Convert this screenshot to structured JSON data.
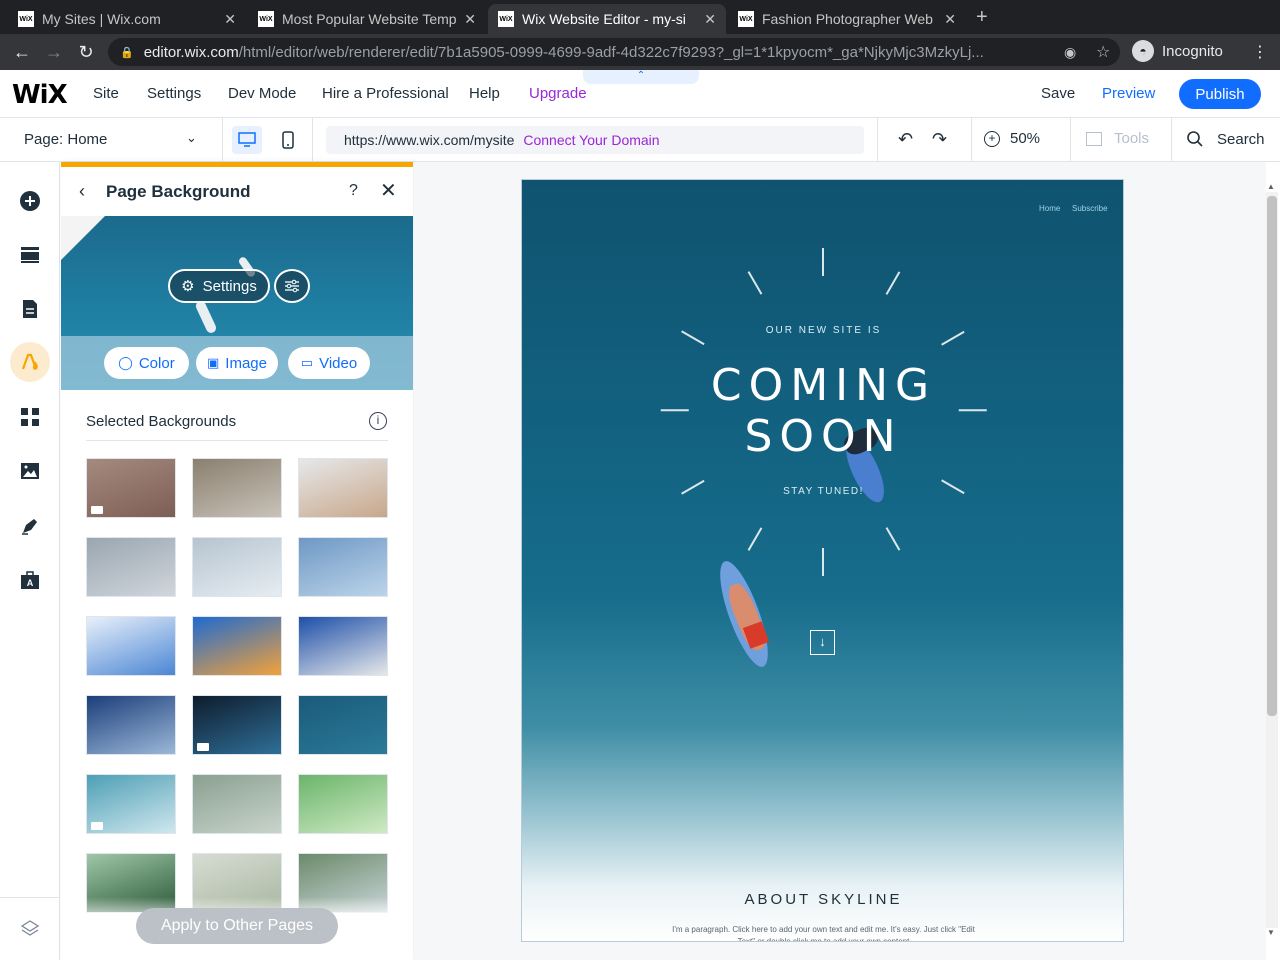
{
  "browser": {
    "tabs": [
      {
        "favicon": "WiX",
        "title": "My Sites | Wix.com",
        "active": false
      },
      {
        "favicon": "WiX",
        "title": "Most Popular Website Temp",
        "active": false
      },
      {
        "favicon": "WiX",
        "title": "Wix Website Editor - my-si",
        "active": true
      },
      {
        "favicon": "WiX",
        "title": "Fashion Photographer Web",
        "active": false
      }
    ],
    "url_host": "editor.wix.com",
    "url_path": "/html/editor/web/renderer/edit/7b1a5905-0999-4699-9adf-4d322c7f9293?_gl=1*1kpyocm*_ga*NjkyMjc3MzkyLj...",
    "profile": "Incognito"
  },
  "wix_bar": {
    "logo": "WiX",
    "menu": [
      "Site",
      "Settings",
      "Dev Mode",
      "Hire a Professional",
      "Help",
      "Upgrade"
    ],
    "save": "Save",
    "preview": "Preview",
    "publish": "Publish"
  },
  "toolbar": {
    "page_label": "Page:",
    "page_value": "Home",
    "site_url": "https://www.wix.com/mysite",
    "connect_domain": "Connect Your Domain",
    "zoom": "50%",
    "tools": "Tools",
    "search": "Search"
  },
  "left_rail": {
    "icons": [
      "add-icon",
      "sections-icon",
      "pages-icon",
      "design-icon",
      "apps-icon",
      "media-icon",
      "blog-icon",
      "business-icon",
      "layers-icon"
    ],
    "active": "design-icon",
    "accent": "#f7a600"
  },
  "panel": {
    "title": "Page Background",
    "help": "?",
    "settings_label": "Settings",
    "bg_types": [
      "Color",
      "Image",
      "Video"
    ],
    "selected_label": "Selected Backgrounds",
    "apply_label": "Apply to Other Pages",
    "thumbnails": [
      {
        "name": "thumb-fabric",
        "video": true
      },
      {
        "name": "thumb-mountain-cabin",
        "video": false
      },
      {
        "name": "thumb-yoga-pose",
        "video": false
      },
      {
        "name": "thumb-paper-cups",
        "video": false
      },
      {
        "name": "thumb-sculpture",
        "video": false
      },
      {
        "name": "thumb-glass-building",
        "video": false
      },
      {
        "name": "thumb-santorini",
        "video": false
      },
      {
        "name": "thumb-citrus-still-life",
        "video": false
      },
      {
        "name": "thumb-tennis-player",
        "video": false
      },
      {
        "name": "thumb-skyscrapers",
        "video": false
      },
      {
        "name": "thumb-stormy-sky",
        "video": true
      },
      {
        "name": "thumb-ocean-surfers",
        "video": false
      },
      {
        "name": "thumb-calm-sea",
        "video": true
      },
      {
        "name": "thumb-woman-reading",
        "video": false
      },
      {
        "name": "thumb-green-juice",
        "video": false
      },
      {
        "name": "thumb-avocados",
        "video": false
      },
      {
        "name": "thumb-product-box",
        "video": false
      },
      {
        "name": "thumb-lake-landscape",
        "video": false
      }
    ]
  },
  "site": {
    "nav": [
      "Home",
      "Subscribe"
    ],
    "eyebrow": "OUR NEW SITE IS",
    "headline1": "COMING",
    "headline2": "SOON",
    "tagline": "STAY TUNED!",
    "about_title": "ABOUT SKYLINE",
    "about_text": "I'm a paragraph. Click here to add your own text and edit me. It's easy. Just click \"Edit Text\" or double click me to add your own content"
  }
}
